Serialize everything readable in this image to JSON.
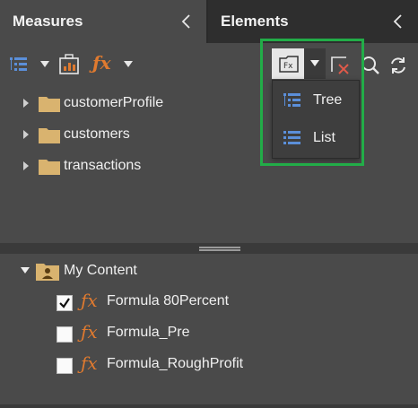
{
  "tabs": {
    "measures": {
      "label": "Measures"
    },
    "elements": {
      "label": "Elements"
    }
  },
  "toolbar": {
    "icons": [
      "hierarchy-icon",
      "dropdown-caret",
      "calculator-icon",
      "fx-icon",
      "dropdown-caret",
      "folder-fx-icon",
      "close-icon",
      "search-icon",
      "refresh-icon"
    ]
  },
  "view_menu": {
    "options": [
      {
        "label": "Tree",
        "icon": "tree-view-icon"
      },
      {
        "label": "List",
        "icon": "list-view-icon"
      }
    ]
  },
  "measures": {
    "folders": [
      {
        "label": "customerProfile"
      },
      {
        "label": "customers"
      },
      {
        "label": "transactions"
      }
    ]
  },
  "my_content": {
    "label": "My Content",
    "items": [
      {
        "label": "Formula 80Percent",
        "checked": true
      },
      {
        "label": "Formula_Pre",
        "checked": false
      },
      {
        "label": "Formula_RoughProfit",
        "checked": false
      }
    ]
  },
  "colors": {
    "accent_orange": "#e07a2f",
    "highlight_green": "#22ad48",
    "folder_tan": "#d9b36f",
    "icon_blue": "#5b8fd9"
  }
}
